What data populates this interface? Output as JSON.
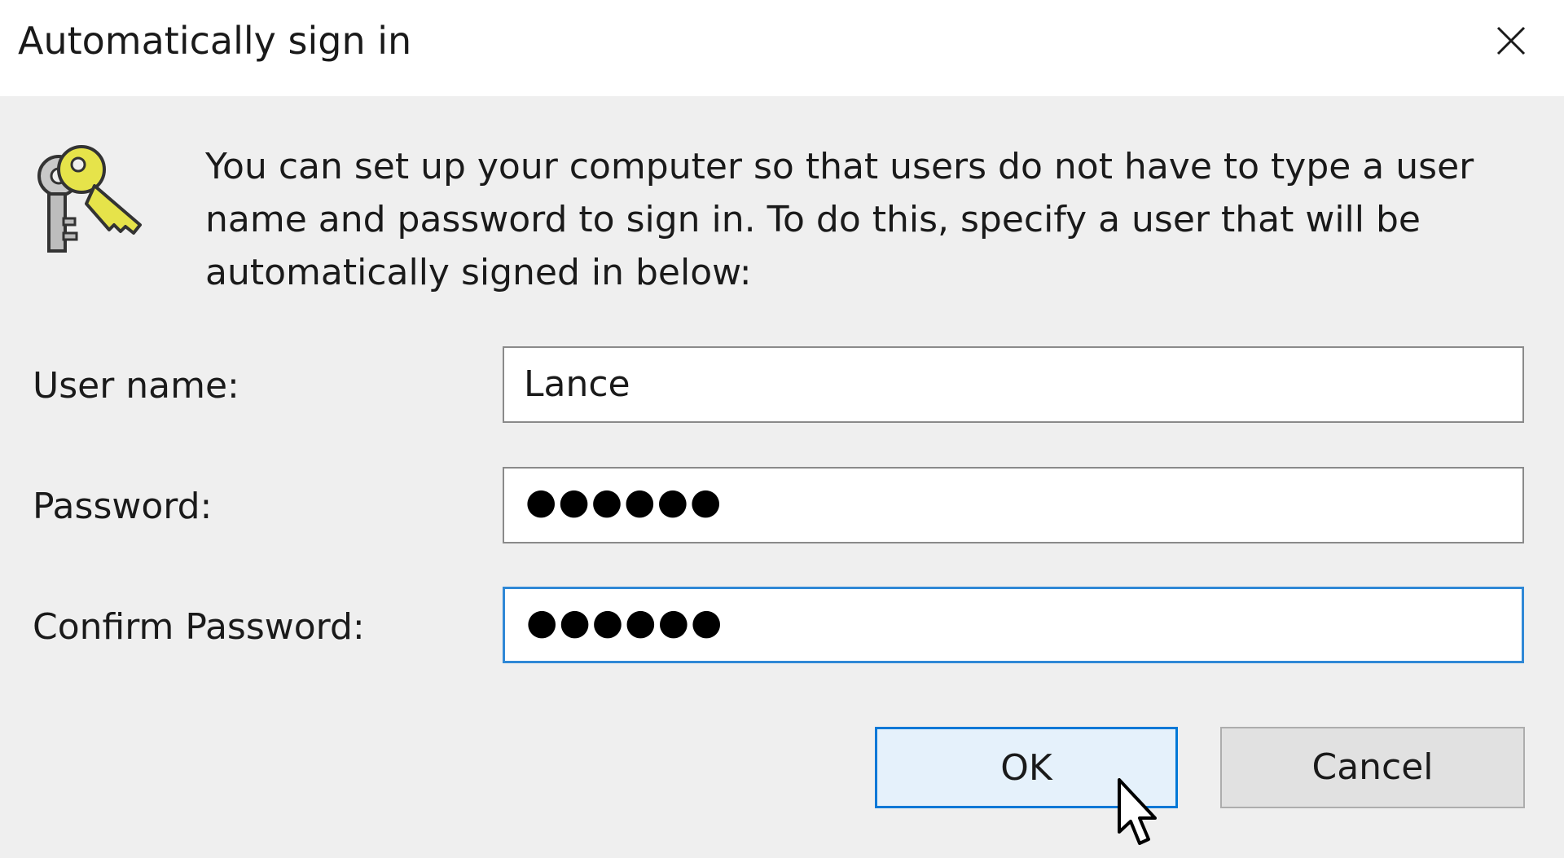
{
  "window": {
    "title": "Automatically sign in"
  },
  "description": "You can set up your computer so that users do not have to type a user name and password to sign in. To do this, specify a user that will be automatically signed in below:",
  "fields": {
    "username": {
      "label": "User name:",
      "value": "Lance"
    },
    "password": {
      "label": "Password:",
      "masked_value": "●●●●●●"
    },
    "confirm_password": {
      "label": "Confirm Password:",
      "masked_value": "●●●●●●"
    }
  },
  "buttons": {
    "ok": "OK",
    "cancel": "Cancel"
  },
  "icons": {
    "header": "keys-icon",
    "close": "close-icon",
    "pointer": "mouse-cursor-icon"
  },
  "colors": {
    "focus_border": "#2f88d6",
    "ok_border": "#0078d7",
    "ok_background": "#e5f1fb",
    "key_yellow": "#e6e34a"
  }
}
